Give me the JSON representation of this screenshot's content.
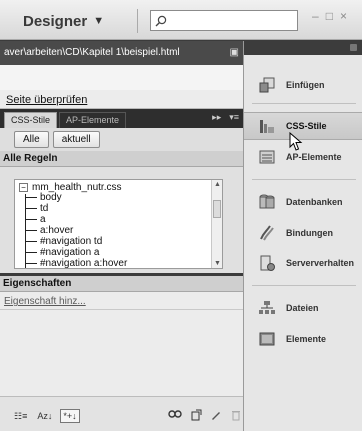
{
  "topbar": {
    "workspace_label": "Designer",
    "search_placeholder": "",
    "minimize": "–",
    "maximize": "□",
    "close": "×"
  },
  "document": {
    "path": "aver\\arbeiten\\CD\\Kapitel 1\\beispiel.html",
    "check_page_label": "Seite überprüfen"
  },
  "css_panel": {
    "tabs": [
      {
        "label": "CSS-Stile",
        "active": true
      },
      {
        "label": "AP-Elemente",
        "active": false
      }
    ],
    "buttons": {
      "all": "Alle",
      "current": "aktuell"
    },
    "all_rules_title": "Alle Regeln",
    "stylesheet": "mm_health_nutr.css",
    "rules": [
      "body",
      "td",
      "a",
      "a:hover",
      "#navigation td",
      "#navigation a",
      "#navigation a:hover"
    ],
    "properties_title": "Eigenschaften",
    "add_property_link": "Eigenschaft hinz...",
    "bottom_toolbar": {
      "sort_label": "Az↓",
      "show_set": "*+↓"
    }
  },
  "dock": {
    "items": [
      {
        "label": "Einfügen",
        "icon": "insert-icon",
        "selected": false
      },
      {
        "label": "CSS-Stile",
        "icon": "css-styles-icon",
        "selected": true
      },
      {
        "label": "AP-Elemente",
        "icon": "ap-elements-icon",
        "selected": false
      },
      {
        "label": "Datenbanken",
        "icon": "databases-icon",
        "selected": false
      },
      {
        "label": "Bindungen",
        "icon": "bindings-icon",
        "selected": false
      },
      {
        "label": "Serververhalten",
        "icon": "server-behaviors-icon",
        "selected": false
      },
      {
        "label": "Dateien",
        "icon": "files-icon",
        "selected": false
      },
      {
        "label": "Elemente",
        "icon": "assets-icon",
        "selected": false
      }
    ]
  }
}
